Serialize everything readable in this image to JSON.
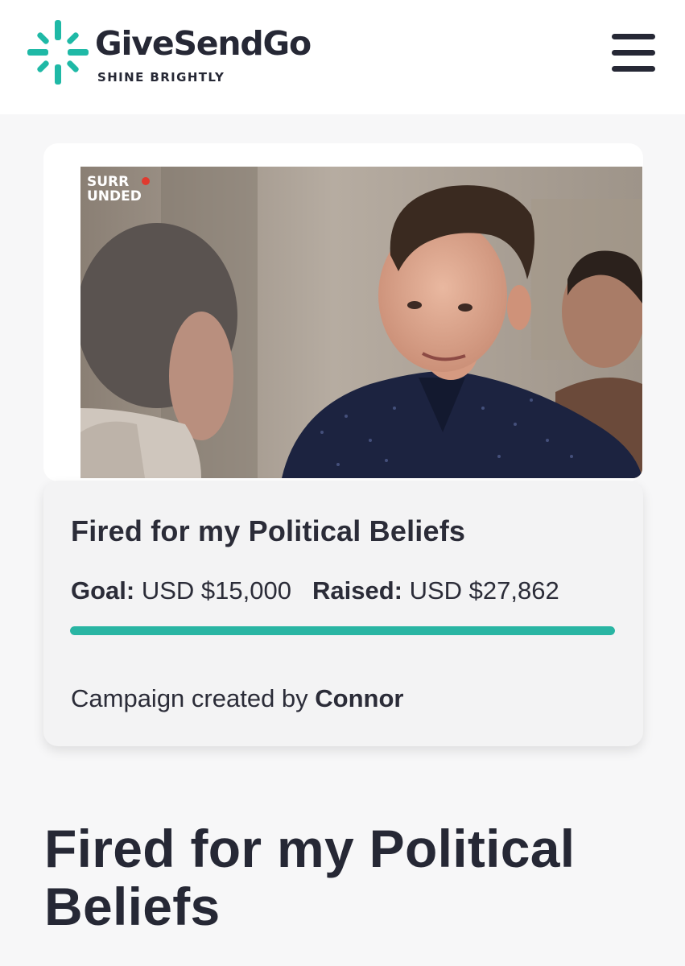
{
  "header": {
    "brand_name": "GiveSendGo",
    "tagline": "SHINE BRIGHTLY",
    "brand_color": "#1fb9a6",
    "menu_icon": "hamburger-menu-icon"
  },
  "campaign": {
    "photo_watermark_line1": "SURR",
    "photo_watermark_line2": "UNDED",
    "card_title": "Fired for my Political Beliefs",
    "goal_label": "Goal:",
    "goal_value": "USD $15,000",
    "raised_label": "Raised:",
    "raised_value": "USD $27,862",
    "progress_fraction": 1.0,
    "progress_color": "#29b5a3",
    "created_by_prefix": "Campaign created by",
    "creator_name": "Connor",
    "page_title": "Fired for my Political Beliefs"
  }
}
